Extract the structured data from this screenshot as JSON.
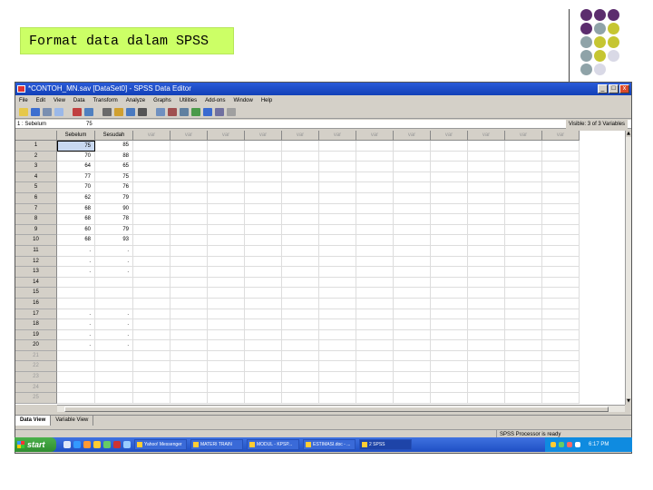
{
  "slide": {
    "title": "Format data dalam SPSS",
    "dot_colors": [
      "#5c2d6e",
      "#8fa3a8",
      "#c6c632",
      "#d9d9e6"
    ]
  },
  "window": {
    "title": "*CONTOH_MN.sav [DataSet0] - SPSS Data Editor",
    "controls": [
      "_",
      "□",
      "x"
    ]
  },
  "menu": [
    "File",
    "Edit",
    "View",
    "Data",
    "Transform",
    "Analyze",
    "Graphs",
    "Utilities",
    "Add-ons",
    "Window",
    "Help"
  ],
  "cell_editor": {
    "ref": "1 : Sebelum",
    "value": "75",
    "visible_info": "Visible: 3 of 3 Variables"
  },
  "grid": {
    "columns": [
      "Sebelum",
      "Sesudah",
      "var",
      "var",
      "var",
      "var",
      "var",
      "var",
      "var",
      "var",
      "var",
      "var",
      "var",
      "var"
    ],
    "rows": [
      {
        "n": "1",
        "a": "75",
        "b": "85"
      },
      {
        "n": "2",
        "a": "70",
        "b": "88"
      },
      {
        "n": "3",
        "a": "64",
        "b": "65"
      },
      {
        "n": "4",
        "a": "77",
        "b": "75"
      },
      {
        "n": "5",
        "a": "70",
        "b": "76"
      },
      {
        "n": "6",
        "a": "62",
        "b": "79"
      },
      {
        "n": "7",
        "a": "68",
        "b": "90"
      },
      {
        "n": "8",
        "a": "68",
        "b": "78"
      },
      {
        "n": "9",
        "a": "60",
        "b": "79"
      },
      {
        "n": "10",
        "a": "68",
        "b": "93"
      },
      {
        "n": "11",
        "a": ".",
        "b": "."
      },
      {
        "n": "12",
        "a": ".",
        "b": "."
      },
      {
        "n": "13",
        "a": ".",
        "b": "."
      },
      {
        "n": "14",
        "a": "",
        "b": ""
      },
      {
        "n": "15",
        "a": "",
        "b": ""
      },
      {
        "n": "16",
        "a": "",
        "b": ""
      },
      {
        "n": "17",
        "a": ".",
        "b": "."
      },
      {
        "n": "18",
        "a": ".",
        "b": "."
      },
      {
        "n": "19",
        "a": ".",
        "b": "."
      },
      {
        "n": "20",
        "a": ".",
        "b": "."
      },
      {
        "n": "21",
        "a": "",
        "b": ""
      },
      {
        "n": "22",
        "a": "",
        "b": ""
      },
      {
        "n": "23",
        "a": "",
        "b": ""
      },
      {
        "n": "24",
        "a": "",
        "b": ""
      },
      {
        "n": "25",
        "a": "",
        "b": ""
      }
    ]
  },
  "tabs": [
    "Data View",
    "Variable View"
  ],
  "status": "SPSS Processor is ready",
  "taskbar": {
    "start": "start",
    "tasks": [
      "Yahoo! Messenger",
      "MATERI TRAIN",
      "MODUL - KPSP...",
      "ESTIMASI.doc - ...",
      "2 SPSS"
    ],
    "clock": "6:17 PM"
  }
}
